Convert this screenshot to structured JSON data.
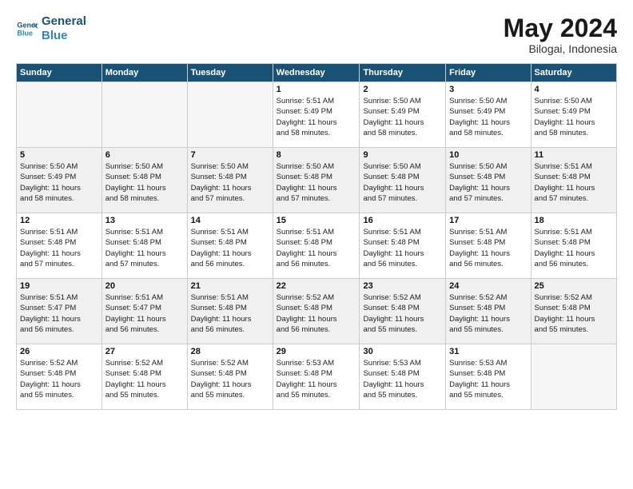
{
  "logo": {
    "line1": "General",
    "line2": "Blue"
  },
  "title": "May 2024",
  "subtitle": "Bilogai, Indonesia",
  "weekdays": [
    "Sunday",
    "Monday",
    "Tuesday",
    "Wednesday",
    "Thursday",
    "Friday",
    "Saturday"
  ],
  "weeks": [
    [
      {
        "day": "",
        "info": ""
      },
      {
        "day": "",
        "info": ""
      },
      {
        "day": "",
        "info": ""
      },
      {
        "day": "1",
        "info": "Sunrise: 5:51 AM\nSunset: 5:49 PM\nDaylight: 11 hours\nand 58 minutes."
      },
      {
        "day": "2",
        "info": "Sunrise: 5:50 AM\nSunset: 5:49 PM\nDaylight: 11 hours\nand 58 minutes."
      },
      {
        "day": "3",
        "info": "Sunrise: 5:50 AM\nSunset: 5:49 PM\nDaylight: 11 hours\nand 58 minutes."
      },
      {
        "day": "4",
        "info": "Sunrise: 5:50 AM\nSunset: 5:49 PM\nDaylight: 11 hours\nand 58 minutes."
      }
    ],
    [
      {
        "day": "5",
        "info": "Sunrise: 5:50 AM\nSunset: 5:49 PM\nDaylight: 11 hours\nand 58 minutes."
      },
      {
        "day": "6",
        "info": "Sunrise: 5:50 AM\nSunset: 5:48 PM\nDaylight: 11 hours\nand 58 minutes."
      },
      {
        "day": "7",
        "info": "Sunrise: 5:50 AM\nSunset: 5:48 PM\nDaylight: 11 hours\nand 57 minutes."
      },
      {
        "day": "8",
        "info": "Sunrise: 5:50 AM\nSunset: 5:48 PM\nDaylight: 11 hours\nand 57 minutes."
      },
      {
        "day": "9",
        "info": "Sunrise: 5:50 AM\nSunset: 5:48 PM\nDaylight: 11 hours\nand 57 minutes."
      },
      {
        "day": "10",
        "info": "Sunrise: 5:50 AM\nSunset: 5:48 PM\nDaylight: 11 hours\nand 57 minutes."
      },
      {
        "day": "11",
        "info": "Sunrise: 5:51 AM\nSunset: 5:48 PM\nDaylight: 11 hours\nand 57 minutes."
      }
    ],
    [
      {
        "day": "12",
        "info": "Sunrise: 5:51 AM\nSunset: 5:48 PM\nDaylight: 11 hours\nand 57 minutes."
      },
      {
        "day": "13",
        "info": "Sunrise: 5:51 AM\nSunset: 5:48 PM\nDaylight: 11 hours\nand 57 minutes."
      },
      {
        "day": "14",
        "info": "Sunrise: 5:51 AM\nSunset: 5:48 PM\nDaylight: 11 hours\nand 56 minutes."
      },
      {
        "day": "15",
        "info": "Sunrise: 5:51 AM\nSunset: 5:48 PM\nDaylight: 11 hours\nand 56 minutes."
      },
      {
        "day": "16",
        "info": "Sunrise: 5:51 AM\nSunset: 5:48 PM\nDaylight: 11 hours\nand 56 minutes."
      },
      {
        "day": "17",
        "info": "Sunrise: 5:51 AM\nSunset: 5:48 PM\nDaylight: 11 hours\nand 56 minutes."
      },
      {
        "day": "18",
        "info": "Sunrise: 5:51 AM\nSunset: 5:48 PM\nDaylight: 11 hours\nand 56 minutes."
      }
    ],
    [
      {
        "day": "19",
        "info": "Sunrise: 5:51 AM\nSunset: 5:47 PM\nDaylight: 11 hours\nand 56 minutes."
      },
      {
        "day": "20",
        "info": "Sunrise: 5:51 AM\nSunset: 5:47 PM\nDaylight: 11 hours\nand 56 minutes."
      },
      {
        "day": "21",
        "info": "Sunrise: 5:51 AM\nSunset: 5:48 PM\nDaylight: 11 hours\nand 56 minutes."
      },
      {
        "day": "22",
        "info": "Sunrise: 5:52 AM\nSunset: 5:48 PM\nDaylight: 11 hours\nand 56 minutes."
      },
      {
        "day": "23",
        "info": "Sunrise: 5:52 AM\nSunset: 5:48 PM\nDaylight: 11 hours\nand 55 minutes."
      },
      {
        "day": "24",
        "info": "Sunrise: 5:52 AM\nSunset: 5:48 PM\nDaylight: 11 hours\nand 55 minutes."
      },
      {
        "day": "25",
        "info": "Sunrise: 5:52 AM\nSunset: 5:48 PM\nDaylight: 11 hours\nand 55 minutes."
      }
    ],
    [
      {
        "day": "26",
        "info": "Sunrise: 5:52 AM\nSunset: 5:48 PM\nDaylight: 11 hours\nand 55 minutes."
      },
      {
        "day": "27",
        "info": "Sunrise: 5:52 AM\nSunset: 5:48 PM\nDaylight: 11 hours\nand 55 minutes."
      },
      {
        "day": "28",
        "info": "Sunrise: 5:52 AM\nSunset: 5:48 PM\nDaylight: 11 hours\nand 55 minutes."
      },
      {
        "day": "29",
        "info": "Sunrise: 5:53 AM\nSunset: 5:48 PM\nDaylight: 11 hours\nand 55 minutes."
      },
      {
        "day": "30",
        "info": "Sunrise: 5:53 AM\nSunset: 5:48 PM\nDaylight: 11 hours\nand 55 minutes."
      },
      {
        "day": "31",
        "info": "Sunrise: 5:53 AM\nSunset: 5:48 PM\nDaylight: 11 hours\nand 55 minutes."
      },
      {
        "day": "",
        "info": ""
      }
    ]
  ]
}
